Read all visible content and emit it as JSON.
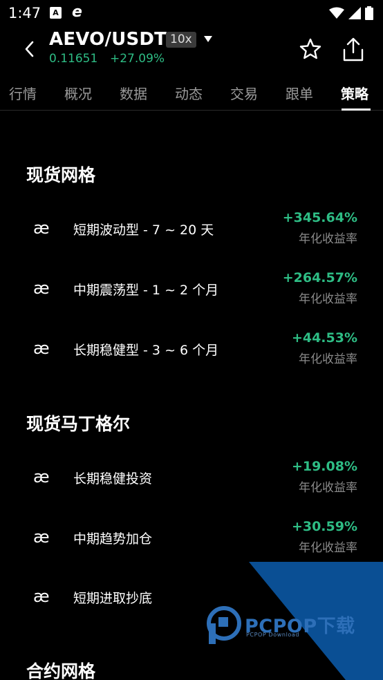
{
  "status_bar": {
    "time": "1:47",
    "icons": [
      "a-badge-icon",
      "e-browser-icon",
      "wifi-icon",
      "signal-icon",
      "battery-icon"
    ]
  },
  "header": {
    "pair": "AEVO/USDT",
    "leverage": "10x",
    "price": "0.11651",
    "change": "+27.09%",
    "accent_color": "#2ebd85"
  },
  "tabs": [
    {
      "label": "行情",
      "active": false
    },
    {
      "label": "概况",
      "active": false
    },
    {
      "label": "数据",
      "active": false
    },
    {
      "label": "动态",
      "active": false
    },
    {
      "label": "交易",
      "active": false
    },
    {
      "label": "跟单",
      "active": false
    },
    {
      "label": "策略",
      "active": true
    }
  ],
  "sections": [
    {
      "title": "现货网格",
      "items": [
        {
          "icon": "æ",
          "label": "短期波动型 - 7 ~ 20 天",
          "value": "+345.64%",
          "sub": "年化收益率"
        },
        {
          "icon": "æ",
          "label": "中期震荡型 - 1 ~ 2 个月",
          "value": "+264.57%",
          "sub": "年化收益率"
        },
        {
          "icon": "æ",
          "label": "长期稳健型 - 3 ~ 6 个月",
          "value": "+44.53%",
          "sub": "年化收益率"
        }
      ]
    },
    {
      "title": "现货马丁格尔",
      "items": [
        {
          "icon": "æ",
          "label": "长期稳健投资",
          "value": "+19.08%",
          "sub": "年化收益率"
        },
        {
          "icon": "æ",
          "label": "中期趋势加仓",
          "value": "+30.59%",
          "sub": "年化收益率"
        },
        {
          "icon": "æ",
          "label": "短期进取抄底",
          "value": "",
          "sub": ""
        }
      ]
    },
    {
      "title": "合约网格",
      "items": []
    }
  ],
  "watermark": {
    "text": "PCPOP下载",
    "sub": "PCPOP Download",
    "color": "#1a5aa0"
  }
}
